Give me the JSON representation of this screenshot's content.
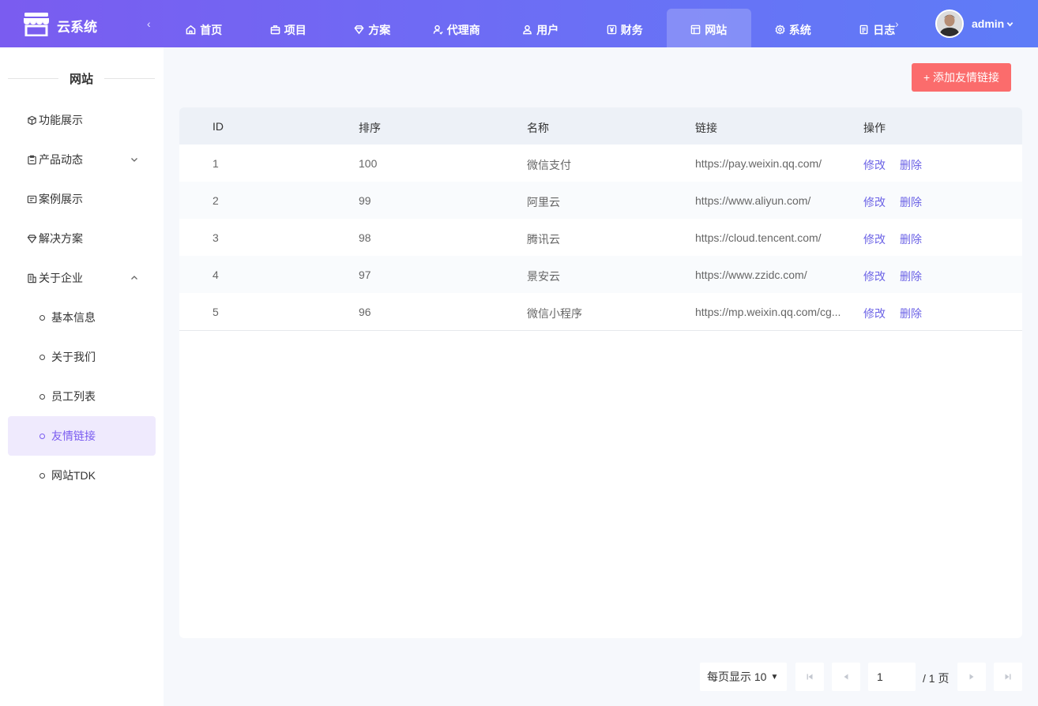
{
  "header": {
    "brand": "云系统",
    "nav": [
      {
        "label": "首页",
        "icon": "home-icon"
      },
      {
        "label": "项目",
        "icon": "briefcase-icon"
      },
      {
        "label": "方案",
        "icon": "diamond-icon"
      },
      {
        "label": "代理商",
        "icon": "agent-icon"
      },
      {
        "label": "用户",
        "icon": "users-icon"
      },
      {
        "label": "财务",
        "icon": "yen-icon"
      },
      {
        "label": "网站",
        "icon": "layout-icon",
        "active": true
      },
      {
        "label": "系统",
        "icon": "gear-icon"
      },
      {
        "label": "日志",
        "icon": "document-icon"
      }
    ],
    "user": "admin"
  },
  "sidebar": {
    "title": "网站",
    "items": [
      {
        "label": "功能展示",
        "icon": "cube-icon"
      },
      {
        "label": "产品动态",
        "icon": "clipboard-icon",
        "expandable": true,
        "expanded": false
      },
      {
        "label": "案例展示",
        "icon": "case-icon"
      },
      {
        "label": "解决方案",
        "icon": "diamond-icon"
      },
      {
        "label": "关于企业",
        "icon": "building-icon",
        "expandable": true,
        "expanded": true
      }
    ],
    "subitems": [
      {
        "label": "基本信息"
      },
      {
        "label": "关于我们"
      },
      {
        "label": "员工列表"
      },
      {
        "label": "友情链接",
        "active": true
      },
      {
        "label": "网站TDK"
      }
    ]
  },
  "main": {
    "add_button": "+ 添加友情链接",
    "columns": [
      "ID",
      "排序",
      "名称",
      "链接",
      "操作"
    ],
    "rows": [
      {
        "id": "1",
        "sort": "100",
        "name": "微信支付",
        "link": "https://pay.weixin.qq.com/"
      },
      {
        "id": "2",
        "sort": "99",
        "name": "阿里云",
        "link": "https://www.aliyun.com/"
      },
      {
        "id": "3",
        "sort": "98",
        "name": "腾讯云",
        "link": "https://cloud.tencent.com/"
      },
      {
        "id": "4",
        "sort": "97",
        "name": "景安云",
        "link": "https://www.zzidc.com/"
      },
      {
        "id": "5",
        "sort": "96",
        "name": "微信小程序",
        "link": "https://mp.weixin.qq.com/cg..."
      }
    ],
    "edit_label": "修改",
    "delete_label": "删除"
  },
  "pagination": {
    "page_size_label": "每页显示 10",
    "current_page": "1",
    "total_label": "/ 1 页"
  },
  "colors": {
    "header_gradient_start": "#7a5cf0",
    "header_gradient_end": "#5e7cf7",
    "accent": "#6c63e6",
    "danger_button": "#fb6c6c",
    "active_sidebar_bg": "#efeafd"
  }
}
